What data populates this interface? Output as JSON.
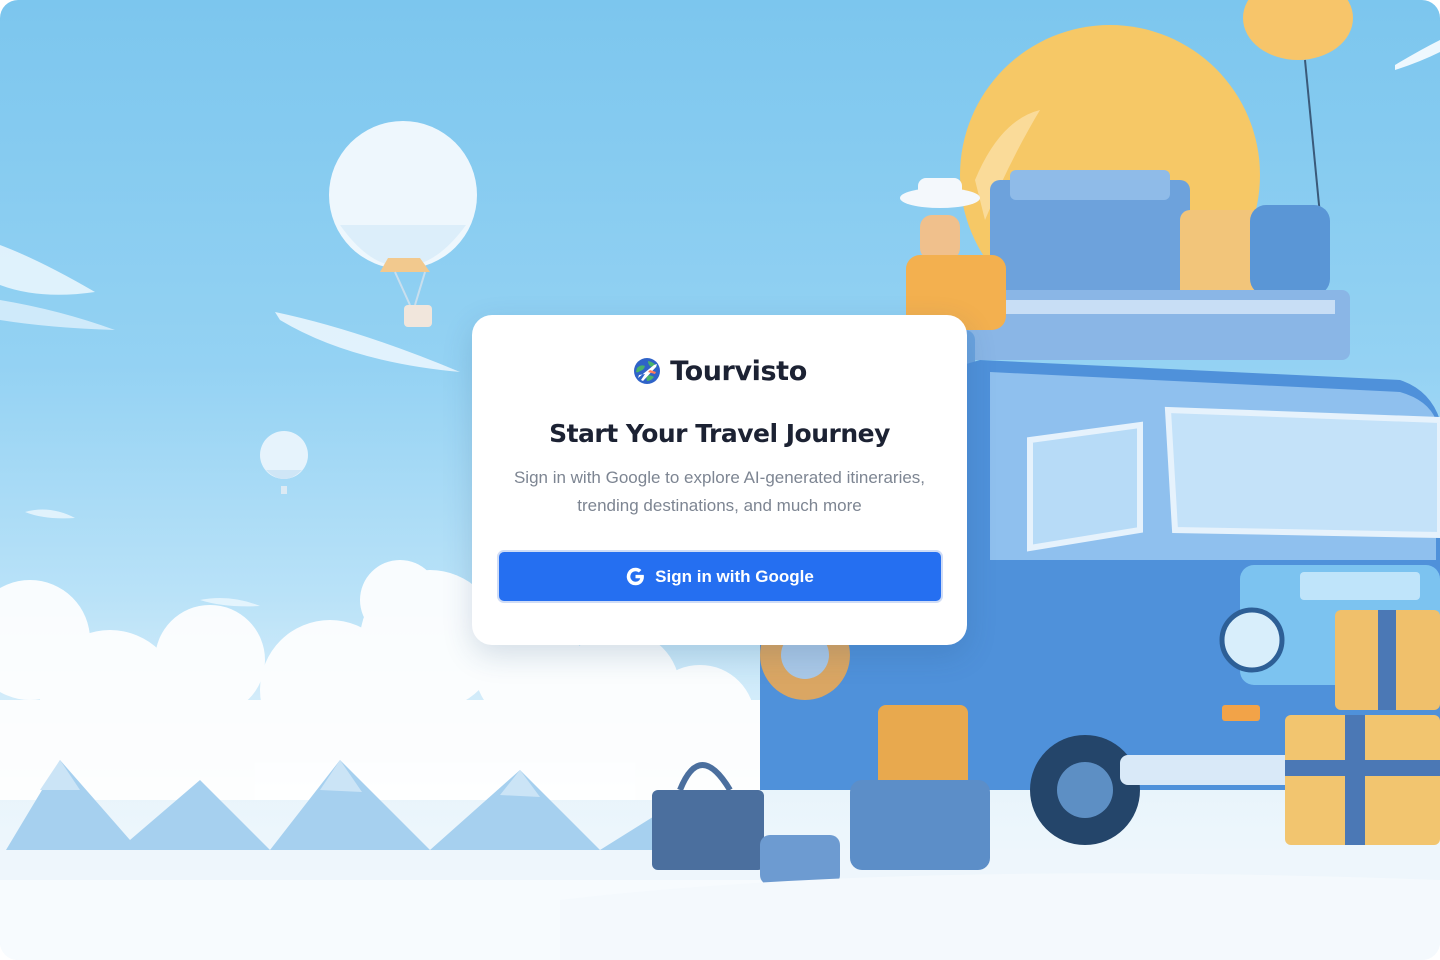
{
  "brand": {
    "name": "Tourvisto",
    "logo_icon": "globe-airplane-icon"
  },
  "auth": {
    "title": "Start Your Travel Journey",
    "subtitle": "Sign in with Google to explore AI-generated itineraries, trending destinations, and much more",
    "google_button_label": "Sign in with Google",
    "google_icon": "google-g-icon"
  },
  "colors": {
    "primary_button": "#256ff1",
    "heading": "#1c2233",
    "muted_text": "#7d8592",
    "sky": "#7cc6ee"
  }
}
